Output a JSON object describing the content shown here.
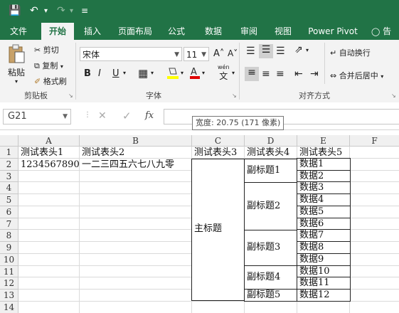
{
  "quick_access": {
    "save": "💾",
    "undo": "↶",
    "undo_dd": "▾",
    "redo": "↷",
    "redo_dd": "▾",
    "customize": "≡"
  },
  "tabs": [
    "文件",
    "开始",
    "插入",
    "页面布局",
    "公式",
    "数据",
    "审阅",
    "视图",
    "Power Pivot",
    "告诉"
  ],
  "ribbon": {
    "clipboard": {
      "paste": "粘贴",
      "cut": "剪切",
      "copy": "复制",
      "format_painter": "格式刷",
      "group": "剪贴板"
    },
    "font": {
      "name": "宋体",
      "size": "11",
      "grow": "A˄",
      "shrink": "A˅",
      "bold": "B",
      "italic": "I",
      "underline": "U",
      "wen": "wén",
      "wen_char": "文",
      "group": "字体"
    },
    "align": {
      "wrap": "自动换行",
      "merge": "合并后居中",
      "group": "对齐方式"
    }
  },
  "formula_bar": {
    "name_box": "G21",
    "cancel": "✕",
    "enter": "✓",
    "fx": "fx"
  },
  "tooltip": "宽度: 20.75 (171 像素)",
  "columns": [
    "A",
    "B",
    "C",
    "D",
    "E",
    "F"
  ],
  "rows": [
    "1",
    "2",
    "3",
    "4",
    "5",
    "6",
    "7",
    "8",
    "9",
    "10",
    "11",
    "12",
    "13",
    "14"
  ],
  "cells": {
    "A1": "测试表头1",
    "B1": "测试表头2",
    "C1": "测试表头3",
    "D1": "测试表头4",
    "E1": "测试表头5",
    "A2": "1234567890",
    "B2": "一二三四五六七八九零",
    "C_main": "主标题",
    "D_sub1": "副标题1",
    "D_sub2": "副标题2",
    "D_sub3": "副标题3",
    "D_sub4": "副标题4",
    "D_sub5": "副标题5",
    "E": [
      "数据1",
      "数据2",
      "数据3",
      "数据4",
      "数据5",
      "数据6",
      "数据7",
      "数据8",
      "数据9",
      "数据10",
      "数据11",
      "数据12"
    ]
  }
}
